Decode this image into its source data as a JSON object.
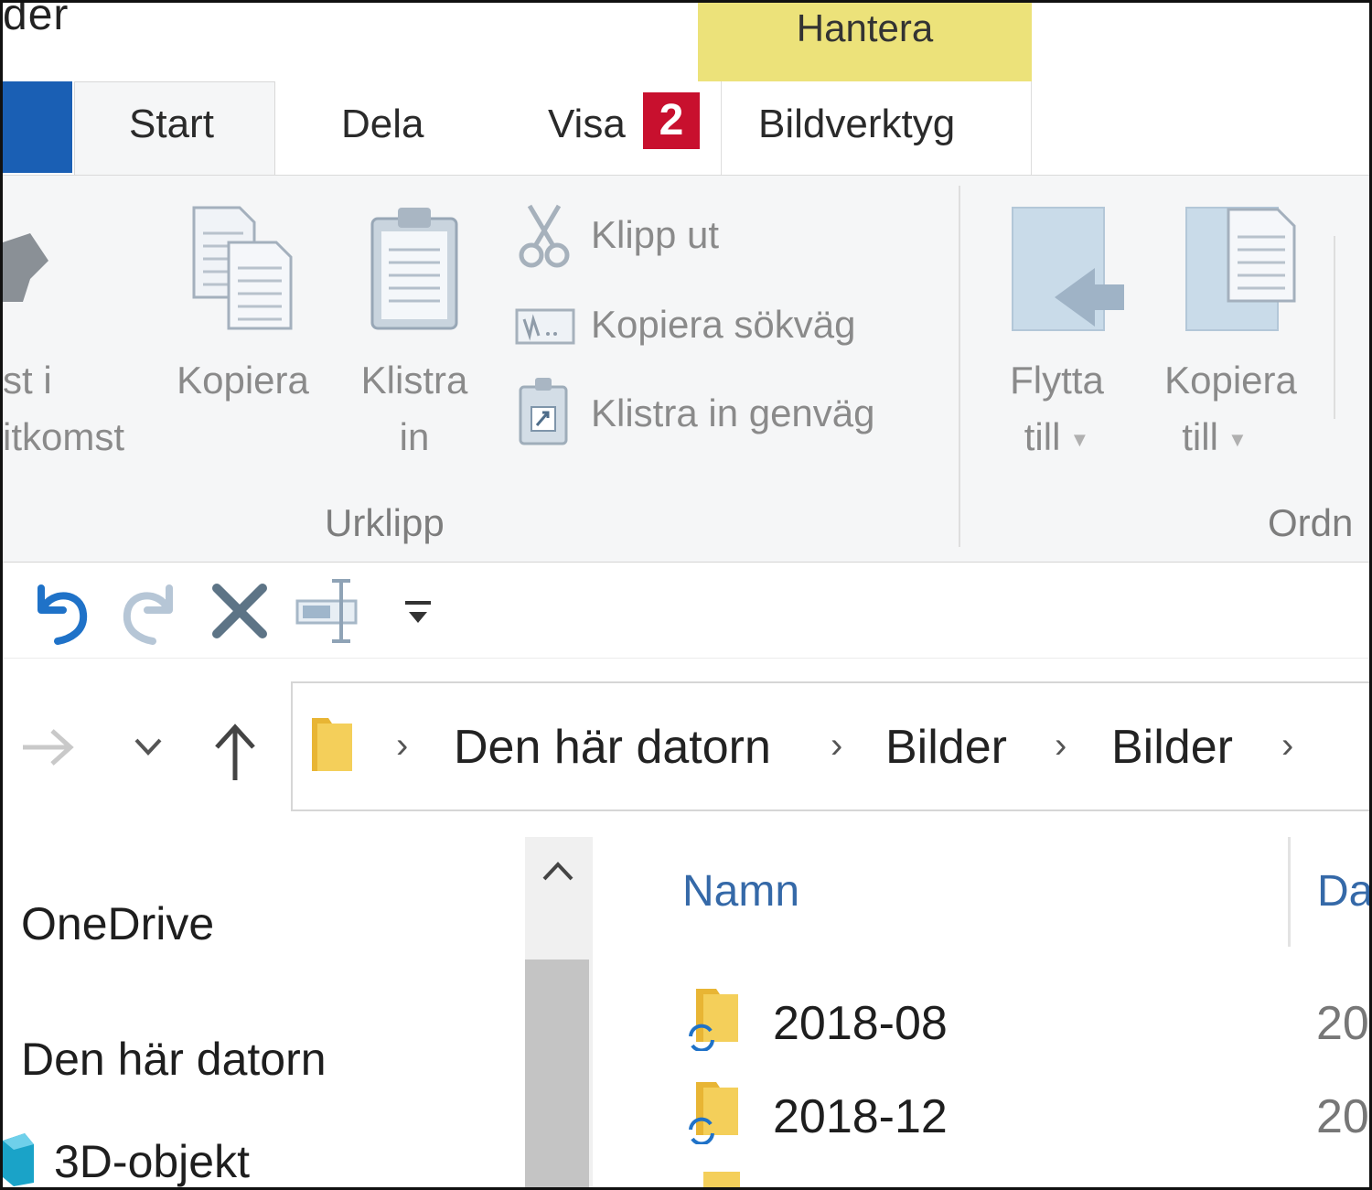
{
  "window": {
    "title_fragment": "der"
  },
  "ribbon_tabs": {
    "contextual_group": "Hantera",
    "start": "Start",
    "dela": "Dela",
    "visa": "Visa",
    "visa_badge": "2",
    "bildverktyg": "Bildverktyg"
  },
  "ribbon": {
    "pin_label_line1": "st i",
    "pin_label_line2": "itkomst",
    "copy": "Kopiera",
    "paste_line1": "Klistra",
    "paste_line2": "in",
    "cut": "Klipp ut",
    "copy_path": "Kopiera sökväg",
    "paste_shortcut": "Klistra in genväg",
    "clipboard_group": "Urklipp",
    "move_to_line1": "Flytta",
    "move_to_line2": "till",
    "copy_to_line1": "Kopiera",
    "copy_to_line2": "till",
    "organize_group": "Ordn"
  },
  "quick_access": {
    "icons": [
      "undo-icon",
      "redo-icon",
      "delete-icon",
      "rename-icon",
      "customize-dropdown-icon"
    ]
  },
  "navigation": {
    "breadcrumbs": [
      "Den här datorn",
      "Bilder",
      "Bilder"
    ]
  },
  "nav_pane": {
    "items": [
      "OneDrive",
      "Den här datorn",
      "3D-objekt"
    ]
  },
  "file_list": {
    "columns": {
      "name": "Namn",
      "date": "Da"
    },
    "rows": [
      {
        "name": "2018-08",
        "date": "20"
      },
      {
        "name": "2018-12",
        "date": "20"
      }
    ]
  },
  "colors": {
    "file_tab": "#1a5fb4",
    "contextual": "#ece27a",
    "badge": "#c8102e",
    "folder": "#f2c744"
  }
}
